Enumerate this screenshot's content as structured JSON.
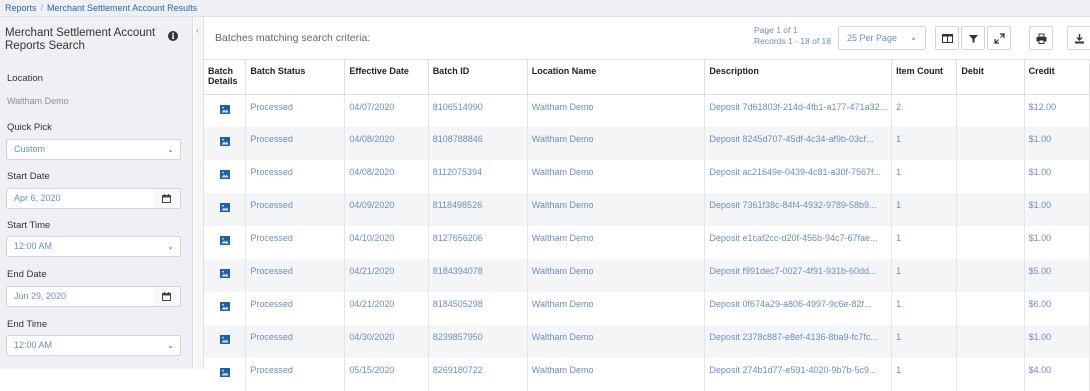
{
  "breadcrumb": {
    "root": "Reports",
    "separator": "/",
    "current": "Merchant Settlement Account Results"
  },
  "sidebar": {
    "title": "Merchant Settlement Account Reports Search",
    "location_label": "Location",
    "location_value": "Waltham Demo",
    "quick_pick_label": "Quick Pick",
    "quick_pick_value": "Custom",
    "start_date_label": "Start Date",
    "start_date_value": "Apr 6, 2020",
    "start_time_label": "Start Time",
    "start_time_value": "12:00 AM",
    "end_date_label": "End Date",
    "end_date_value": "Jun 29, 2020",
    "end_time_label": "End Time",
    "end_time_value": "12:00 AM"
  },
  "results": {
    "title": "Batches matching search criteria:",
    "page_text": "Page 1 of 1",
    "records_text": "Records 1 - 18 of 18",
    "per_page": "25 Per Page",
    "columns": [
      "Batch Details",
      "Batch Status",
      "Effective Date",
      "Batch ID",
      "Location Name",
      "Description",
      "Item Count",
      "Debit",
      "Credit"
    ],
    "rows": [
      {
        "status": "Processed",
        "date": "04/07/2020",
        "id": "8106514990",
        "location": "Waltham Demo",
        "desc": "Deposit 7d61803f-214d-4fb1-a177-471a32...",
        "count": "2",
        "debit": "",
        "credit": "$12.00"
      },
      {
        "status": "Processed",
        "date": "04/08/2020",
        "id": "8108788846",
        "location": "Waltham Demo",
        "desc": "Deposit 8245d707-45df-4c34-af9b-03cf...",
        "count": "1",
        "debit": "",
        "credit": "$1.00"
      },
      {
        "status": "Processed",
        "date": "04/08/2020",
        "id": "8112075394",
        "location": "Waltham Demo",
        "desc": "Deposit ac21649e-0439-4c81-a30f-7567f...",
        "count": "1",
        "debit": "",
        "credit": "$1.00"
      },
      {
        "status": "Processed",
        "date": "04/09/2020",
        "id": "8118498526",
        "location": "Waltham Demo",
        "desc": "Deposit 7361f38c-84f4-4932-9789-58b9...",
        "count": "1",
        "debit": "",
        "credit": "$1.00"
      },
      {
        "status": "Processed",
        "date": "04/10/2020",
        "id": "8127656206",
        "location": "Waltham Demo",
        "desc": "Deposit e1caf2cc-d20f-456b-94c7-67fae...",
        "count": "1",
        "debit": "",
        "credit": "$1.00"
      },
      {
        "status": "Processed",
        "date": "04/21/2020",
        "id": "8184394078",
        "location": "Waltham Demo",
        "desc": "Deposit f991dec7-0027-4f91-931b-60dd...",
        "count": "1",
        "debit": "",
        "credit": "$5.00"
      },
      {
        "status": "Processed",
        "date": "04/21/2020",
        "id": "8184505298",
        "location": "Waltham Demo",
        "desc": "Deposit 0f674a29-a806-4997-9c6e-82f...",
        "count": "1",
        "debit": "",
        "credit": "$6.00"
      },
      {
        "status": "Processed",
        "date": "04/30/2020",
        "id": "8239857950",
        "location": "Waltham Demo",
        "desc": "Deposit 2378c887-e8ef-4136-8ba9-fc7fc...",
        "count": "1",
        "debit": "",
        "credit": "$1.00"
      },
      {
        "status": "Processed",
        "date": "05/15/2020",
        "id": "8269180722",
        "location": "Waltham Demo",
        "desc": "Deposit 274b1d77-e591-4020-9b7b-5c9...",
        "count": "1",
        "debit": "",
        "credit": "$4.00"
      }
    ]
  },
  "icons": {
    "info": "info-icon",
    "calendar": "calendar-icon",
    "columns": "columns-icon",
    "filter": "filter-icon",
    "expand": "expand-icon",
    "print": "print-icon",
    "download": "download-icon",
    "batch_details": "image-icon"
  },
  "colors": {
    "link": "#2a66b8",
    "value": "#6a8fc0",
    "sidebar_bg": "#eef0f3",
    "alt_row": "#f4f5f7"
  }
}
